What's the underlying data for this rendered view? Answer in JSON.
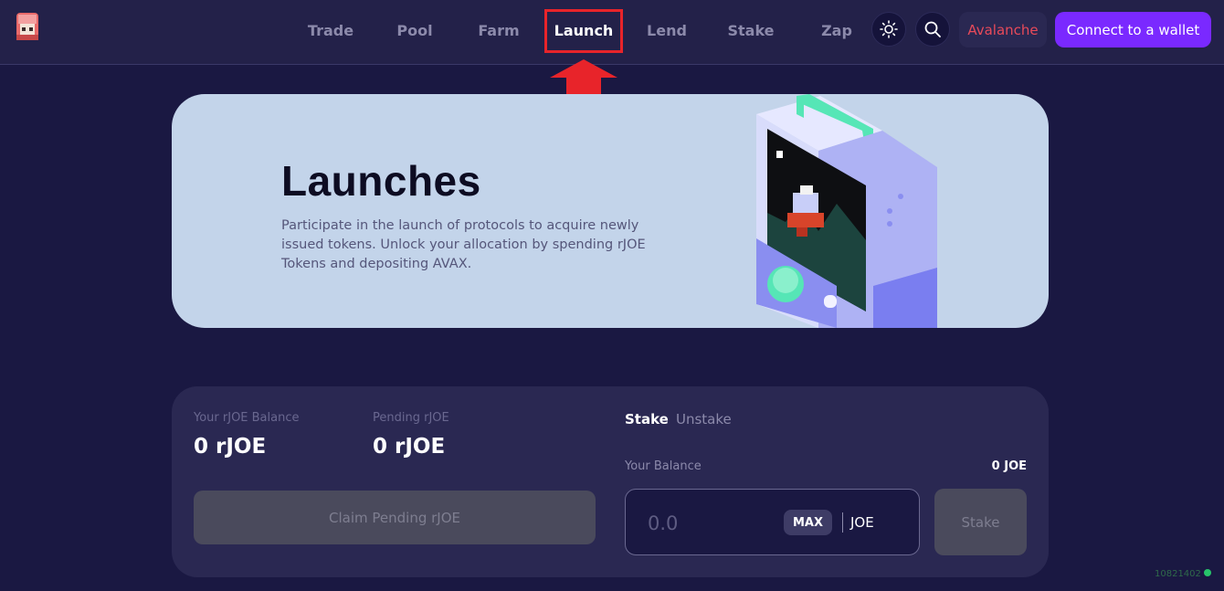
{
  "header": {
    "nav": [
      {
        "label": "Trade"
      },
      {
        "label": "Pool"
      },
      {
        "label": "Farm"
      },
      {
        "label": "Launch"
      },
      {
        "label": "Lend"
      },
      {
        "label": "Stake"
      },
      {
        "label": "Zap"
      }
    ],
    "active_nav": "Launch",
    "theme_icon": "sun-icon",
    "search_icon": "search-icon",
    "network_label": "Avalanche",
    "wallet_label": "Connect to a wallet",
    "colors": {
      "accent": "#7a29ff",
      "network": "#e84a5a",
      "highlight": "#e8242a"
    }
  },
  "hero": {
    "title": "Launches",
    "description": "Participate in the launch of protocols to acquire newly issued tokens. Unlock your allocation by spending rJOE Tokens and depositing AVAX."
  },
  "panel": {
    "rjoe_balance_label": "Your rJOE Balance",
    "rjoe_balance_value": "0 rJOE",
    "pending_label": "Pending rJOE",
    "pending_value": "0 rJOE",
    "claim_label": "Claim Pending rJOE",
    "tabs": [
      {
        "label": "Stake"
      },
      {
        "label": "Unstake"
      }
    ],
    "balance_label": "Your Balance",
    "balance_value": "0 JOE",
    "amount_placeholder": "0.0",
    "max_label": "MAX",
    "token": "JOE",
    "stake_label": "Stake"
  },
  "footer": {
    "block_number": "10821402"
  }
}
